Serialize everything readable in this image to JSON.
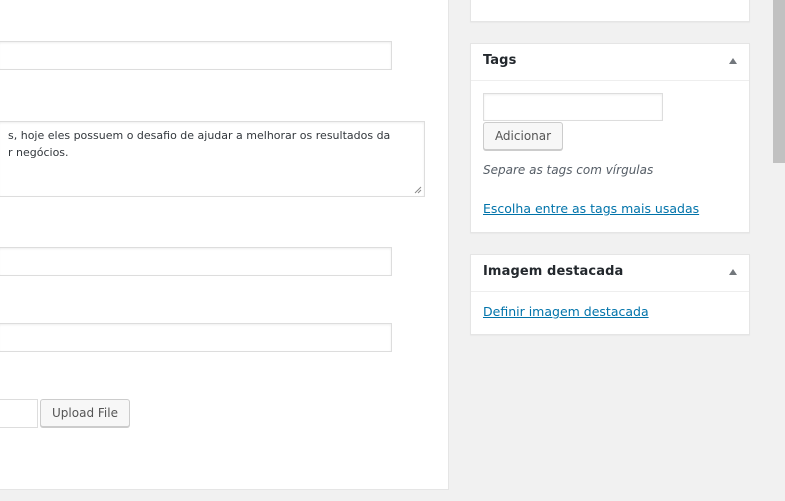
{
  "main": {
    "description_line1": "s, hoje eles possuem o desafio de ajudar a melhorar os resultados da",
    "description_line2": "r negócios.",
    "upload_label": "Upload File"
  },
  "tags_box": {
    "title": "Tags",
    "add_label": "Adicionar",
    "hint": "Separe as tags com vírgulas",
    "most_used_link": "Escolha entre as tags mais usadas"
  },
  "featured_box": {
    "title": "Imagem destacada",
    "set_link": "Definir imagem destacada"
  },
  "icons": {
    "collapse": "triangle-up-icon",
    "resize": "resize-grip-icon"
  },
  "colors": {
    "link": "#0073aa",
    "background": "#f1f1f1"
  }
}
